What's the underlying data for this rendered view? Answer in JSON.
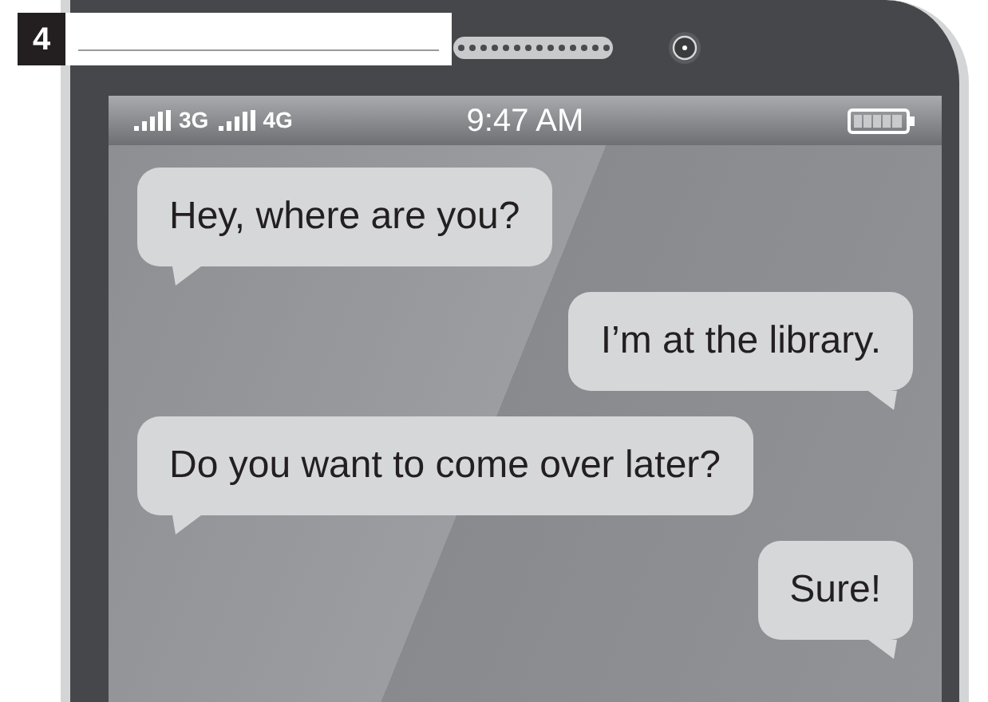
{
  "exercise": {
    "number": "4"
  },
  "status_bar": {
    "networks": [
      "3G",
      "4G"
    ],
    "time": "9:47 AM"
  },
  "messages": [
    {
      "kind": "incoming",
      "text": "Hey, where are you?"
    },
    {
      "kind": "outgoing",
      "text": "I’m at the library."
    },
    {
      "kind": "incoming",
      "text": "Do you want to come over later?"
    },
    {
      "kind": "outgoing",
      "text": "Sure!"
    }
  ]
}
